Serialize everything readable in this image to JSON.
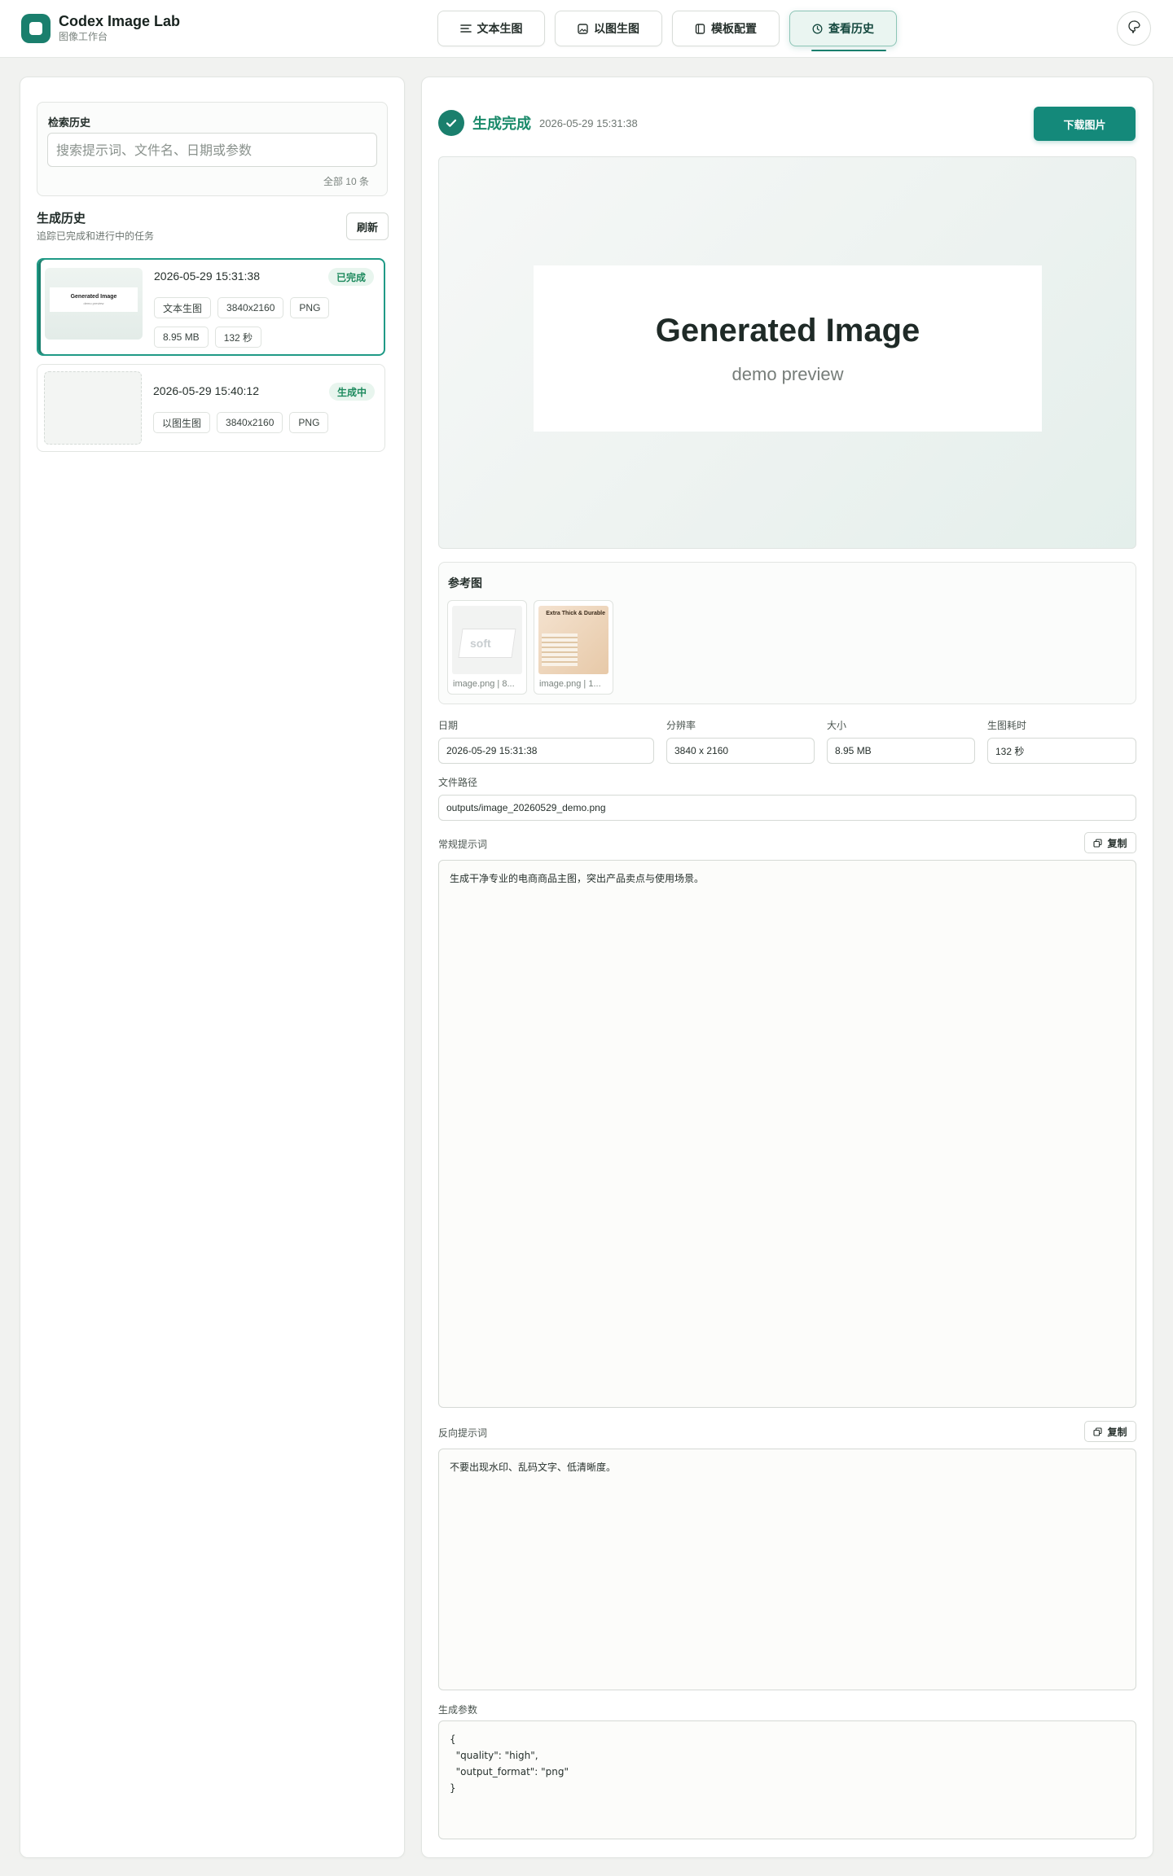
{
  "app": {
    "title": "Codex Image Lab",
    "subtitle": "图像工作台"
  },
  "nav": {
    "tabs": [
      {
        "label": "文本生图",
        "icon": "lines-icon",
        "active": false
      },
      {
        "label": "以图生图",
        "icon": "image-icon",
        "active": false
      },
      {
        "label": "模板配置",
        "icon": "template-icon",
        "active": false
      },
      {
        "label": "查看历史",
        "icon": "clock-icon",
        "active": true
      }
    ]
  },
  "search": {
    "label": "检索历史",
    "placeholder": "搜索提示词、文件名、日期或参数",
    "value": "",
    "count": "全部 10 条"
  },
  "history": {
    "title": "生成历史",
    "subtitle": "追踪已完成和进行中的任务",
    "refresh_label": "刷新",
    "items": [
      {
        "date": "2026-05-29 15:31:38",
        "status": "已完成",
        "thumb_title": "Generated Image",
        "thumb_sub": "demo preview",
        "chips": [
          "文本生图",
          "3840x2160",
          "PNG",
          "8.95 MB",
          "132 秒"
        ]
      },
      {
        "date": "2026-05-29 15:40:12",
        "status": "生成中",
        "chips": [
          "以图生图",
          "3840x2160",
          "PNG"
        ]
      }
    ]
  },
  "detail": {
    "status": "生成完成",
    "time": "2026-05-29 15:31:38",
    "download_label": "下载图片",
    "preview_title": "Generated Image",
    "preview_sub": "demo preview",
    "reference": {
      "title": "参考图",
      "items": [
        {
          "caption": "image.png | 8...",
          "art_text": "soft"
        },
        {
          "caption": "image.png | 1...",
          "art_text": "Extra Thick & Durable"
        }
      ]
    },
    "fields": {
      "date_label": "日期",
      "date": "2026-05-29 15:31:38",
      "res_label": "分辨率",
      "res": "3840 x 2160",
      "size_label": "大小",
      "size": "8.95 MB",
      "duration_label": "生图耗时",
      "duration": "132 秒",
      "path_label": "文件路径",
      "path": "outputs/image_20260529_demo.png"
    },
    "prompt_label": "常规提示词",
    "prompt": "生成干净专业的电商商品主图，突出产品卖点与使用场景。",
    "neg_label": "反向提示词",
    "neg": "不要出现水印、乱码文字、低清晰度。",
    "copy_label": "复制",
    "params_label": "生成参数",
    "params": "{\n  \"quality\": \"high\",\n  \"output_format\": \"png\"\n}"
  },
  "colors": {
    "accent": "#1a7f6d",
    "button": "#14897a",
    "success": "#1d8a5e"
  }
}
